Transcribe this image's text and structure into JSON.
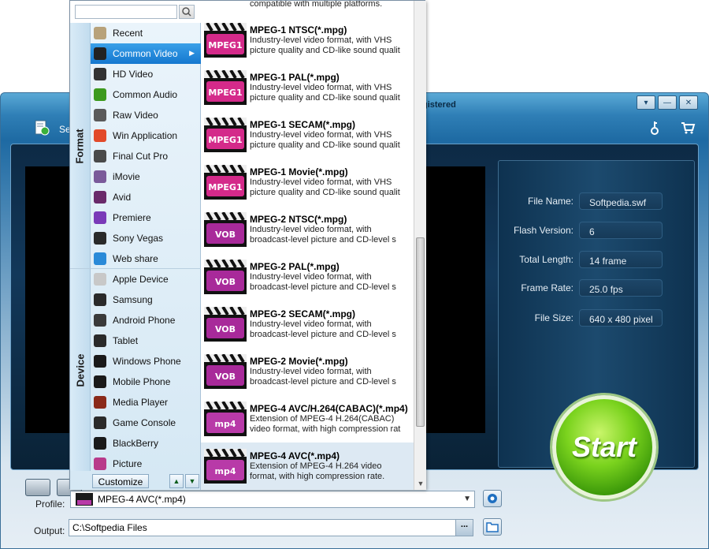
{
  "app": {
    "title": "gistered",
    "toolbar_label": "Se",
    "window_buttons": [
      "▾",
      "—",
      "✕"
    ]
  },
  "info": {
    "rows": [
      {
        "label": "File Name:",
        "value": "Softpedia.swf"
      },
      {
        "label": "Flash Version:",
        "value": "6"
      },
      {
        "label": "Total Length:",
        "value": "14 frame"
      },
      {
        "label": "Frame Rate:",
        "value": "25.0 fps"
      },
      {
        "label": "File Size:",
        "value": "640 x 480 pixel"
      }
    ]
  },
  "start_label": "Start",
  "bottom": {
    "profile_label": "Profile:",
    "profile_value": "MPEG-4 AVC(*.mp4)",
    "output_label": "Output:",
    "output_value": "C:\\Softpedia Files",
    "more_label": "..."
  },
  "popup": {
    "search_placeholder": "",
    "tabs": {
      "format": "Format",
      "device": "Device"
    },
    "format_categories": [
      {
        "label": "Recent",
        "icon": "recent-icon",
        "color": "#b8a27a"
      },
      {
        "label": "Common Video",
        "icon": "clapper-icon",
        "color": "#222222",
        "active": true
      },
      {
        "label": "HD Video",
        "icon": "hd-icon",
        "color": "#333333"
      },
      {
        "label": "Common Audio",
        "icon": "music-note-icon",
        "color": "#3d9a1e"
      },
      {
        "label": "Raw Video",
        "icon": "raw-video-icon",
        "color": "#5a5a5a"
      },
      {
        "label": "Win Application",
        "icon": "windows-icon",
        "color": "#e24a2a"
      },
      {
        "label": "Final Cut Pro",
        "icon": "final-cut-icon",
        "color": "#4a4a4a"
      },
      {
        "label": "iMovie",
        "icon": "star-icon",
        "color": "#7a5a9a"
      },
      {
        "label": "Avid",
        "icon": "avid-icon",
        "color": "#6a2a6a"
      },
      {
        "label": "Premiere",
        "icon": "premiere-icon",
        "color": "#7a3ab8"
      },
      {
        "label": "Sony Vegas",
        "icon": "vegas-icon",
        "color": "#2a2a2a"
      },
      {
        "label": "Web share",
        "icon": "globe-icon",
        "color": "#2a8ad8"
      }
    ],
    "device_categories": [
      {
        "label": "Apple Device",
        "icon": "apple-device-icon",
        "color": "#c8c8c8"
      },
      {
        "label": "Samsung",
        "icon": "phone-icon",
        "color": "#2a2a2a"
      },
      {
        "label": "Android Phone",
        "icon": "android-phone-icon",
        "color": "#3a3a3a"
      },
      {
        "label": "Tablet",
        "icon": "tablet-icon",
        "color": "#2a2a2a"
      },
      {
        "label": "Windows Phone",
        "icon": "windows-phone-icon",
        "color": "#1a1a1a"
      },
      {
        "label": "Mobile Phone",
        "icon": "mobile-phone-icon",
        "color": "#1a1a1a"
      },
      {
        "label": "Media Player",
        "icon": "media-player-icon",
        "color": "#8a2a1a"
      },
      {
        "label": "Game Console",
        "icon": "game-console-icon",
        "color": "#2a2a2a"
      },
      {
        "label": "BlackBerry",
        "icon": "blackberry-icon",
        "color": "#1a1a1a"
      },
      {
        "label": "Picture",
        "icon": "picture-icon",
        "color": "#b83a8a"
      }
    ],
    "customize_label": "Customize",
    "top_partial_desc": "compatible with multiple platforms.",
    "formats": [
      {
        "name": "MPEG-1 NTSC(*.mpg)",
        "desc1": "Industry-level video format, with VHS",
        "desc2": "picture quality and CD-like sound qualit",
        "badge": "MPEG1",
        "badge_color": "#d42a8a"
      },
      {
        "name": "MPEG-1 PAL(*.mpg)",
        "desc1": "Industry-level video format, with VHS",
        "desc2": "picture quality and CD-like sound qualit",
        "badge": "MPEG1",
        "badge_color": "#d42a8a"
      },
      {
        "name": "MPEG-1 SECAM(*.mpg)",
        "desc1": "Industry-level video format, with VHS",
        "desc2": "picture quality and CD-like sound qualit",
        "badge": "MPEG1",
        "badge_color": "#d42a8a"
      },
      {
        "name": "MPEG-1 Movie(*.mpg)",
        "desc1": "Industry-level video format, with VHS",
        "desc2": "picture quality and CD-like sound qualit",
        "badge": "MPEG1",
        "badge_color": "#d42a8a"
      },
      {
        "name": "MPEG-2 NTSC(*.mpg)",
        "desc1": "Industry-level video format, with",
        "desc2": "broadcast-level picture and CD-level s",
        "badge": "VOB",
        "badge_color": "#a82a9a"
      },
      {
        "name": "MPEG-2 PAL(*.mpg)",
        "desc1": "Industry-level video format, with",
        "desc2": "broadcast-level picture and CD-level s",
        "badge": "VOB",
        "badge_color": "#a82a9a"
      },
      {
        "name": "MPEG-2 SECAM(*.mpg)",
        "desc1": "Industry-level video format, with",
        "desc2": "broadcast-level picture and CD-level s",
        "badge": "VOB",
        "badge_color": "#a82a9a"
      },
      {
        "name": "MPEG-2 Movie(*.mpg)",
        "desc1": "Industry-level video format, with",
        "desc2": "broadcast-level picture and CD-level s",
        "badge": "VOB",
        "badge_color": "#a82a9a"
      },
      {
        "name": "MPEG-4 AVC/H.264(CABAC)(*.mp4)",
        "desc1": "Extension of MPEG-4 H.264(CABAC)",
        "desc2": "video format, with high compression rat",
        "badge": "mp4",
        "badge_color": "#b83aa8"
      },
      {
        "name": "MPEG-4 AVC(*.mp4)",
        "desc1": "Extension of MPEG-4 H.264 video",
        "desc2": "format, with high compression rate.",
        "badge": "mp4",
        "badge_color": "#b83aa8",
        "selected": true
      }
    ]
  }
}
